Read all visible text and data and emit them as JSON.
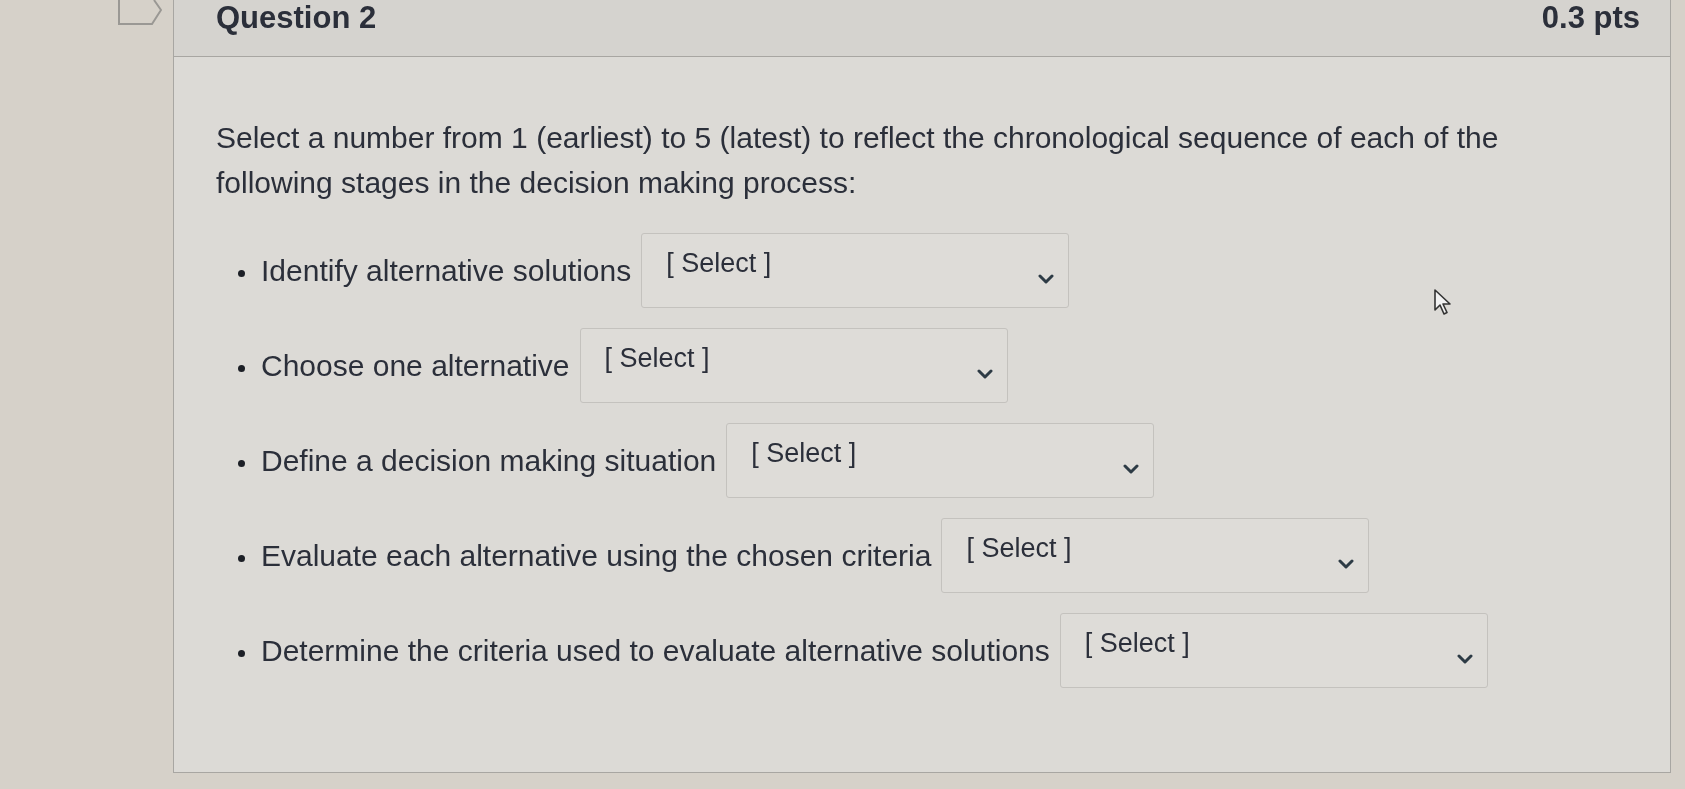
{
  "question": {
    "title": "Question 2",
    "points": "0.3 pts"
  },
  "prompt": "Select a number from 1 (earliest) to 5 (latest) to reflect the chronological sequence of each of the following stages in the decision making process:",
  "items": [
    {
      "label": "Identify alternative solutions",
      "value": "[ Select ]"
    },
    {
      "label": "Choose one alternative",
      "value": "[ Select ]"
    },
    {
      "label": "Define a decision making situation",
      "value": "[ Select ]"
    },
    {
      "label": "Evaluate each alternative using the chosen criteria",
      "value": "[ Select ]"
    },
    {
      "label": "Determine the criteria used to evaluate alternative solutions",
      "value": "[ Select ]"
    }
  ]
}
